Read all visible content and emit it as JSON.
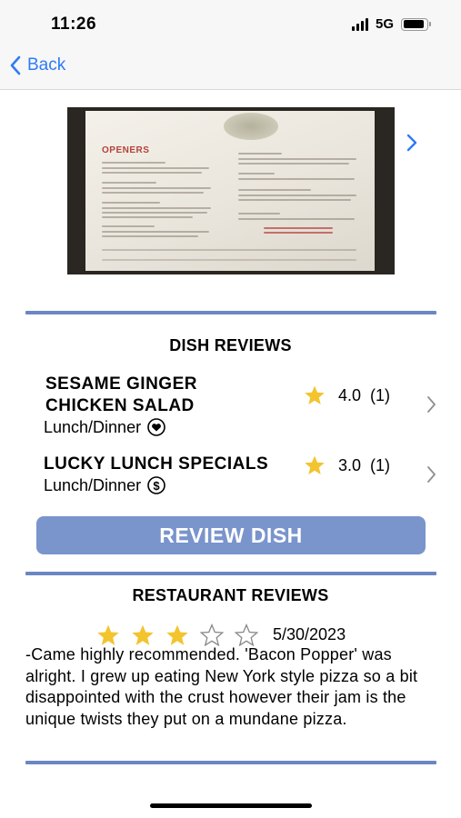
{
  "status_bar": {
    "time": "11:26",
    "network": "5G"
  },
  "nav": {
    "back_label": "Back"
  },
  "menu_photo": {
    "heading": "OPENERS"
  },
  "dish_reviews": {
    "title": "DISH REVIEWS",
    "items": [
      {
        "name_line1": "SESAME GINGER",
        "name_line2": "CHICKEN SALAD",
        "meal": "Lunch/Dinner",
        "badge_icon": "heart-icon",
        "rating": "4.0",
        "count": "(1)"
      },
      {
        "name_line1": "LUCKY LUNCH SPECIALS",
        "name_line2": "",
        "meal": "Lunch/Dinner",
        "badge_icon": "dollar-icon",
        "rating": "3.0",
        "count": "(1)"
      }
    ]
  },
  "review_button": {
    "label": "REVIEW DISH"
  },
  "restaurant_reviews": {
    "title": "RESTAURANT REVIEWS",
    "rating": 3,
    "max_rating": 5,
    "date": "5/30/2023",
    "text": "-Came highly recommended. 'Bacon Popper' was alright.  I grew up eating New York style pizza so a bit disappointed with the crust however their jam is the unique twists they put on a mundane pizza."
  },
  "colors": {
    "accent": "#6b87c3",
    "button": "#7a94cc",
    "star": "#f3c42e",
    "link": "#2f7bf5"
  }
}
